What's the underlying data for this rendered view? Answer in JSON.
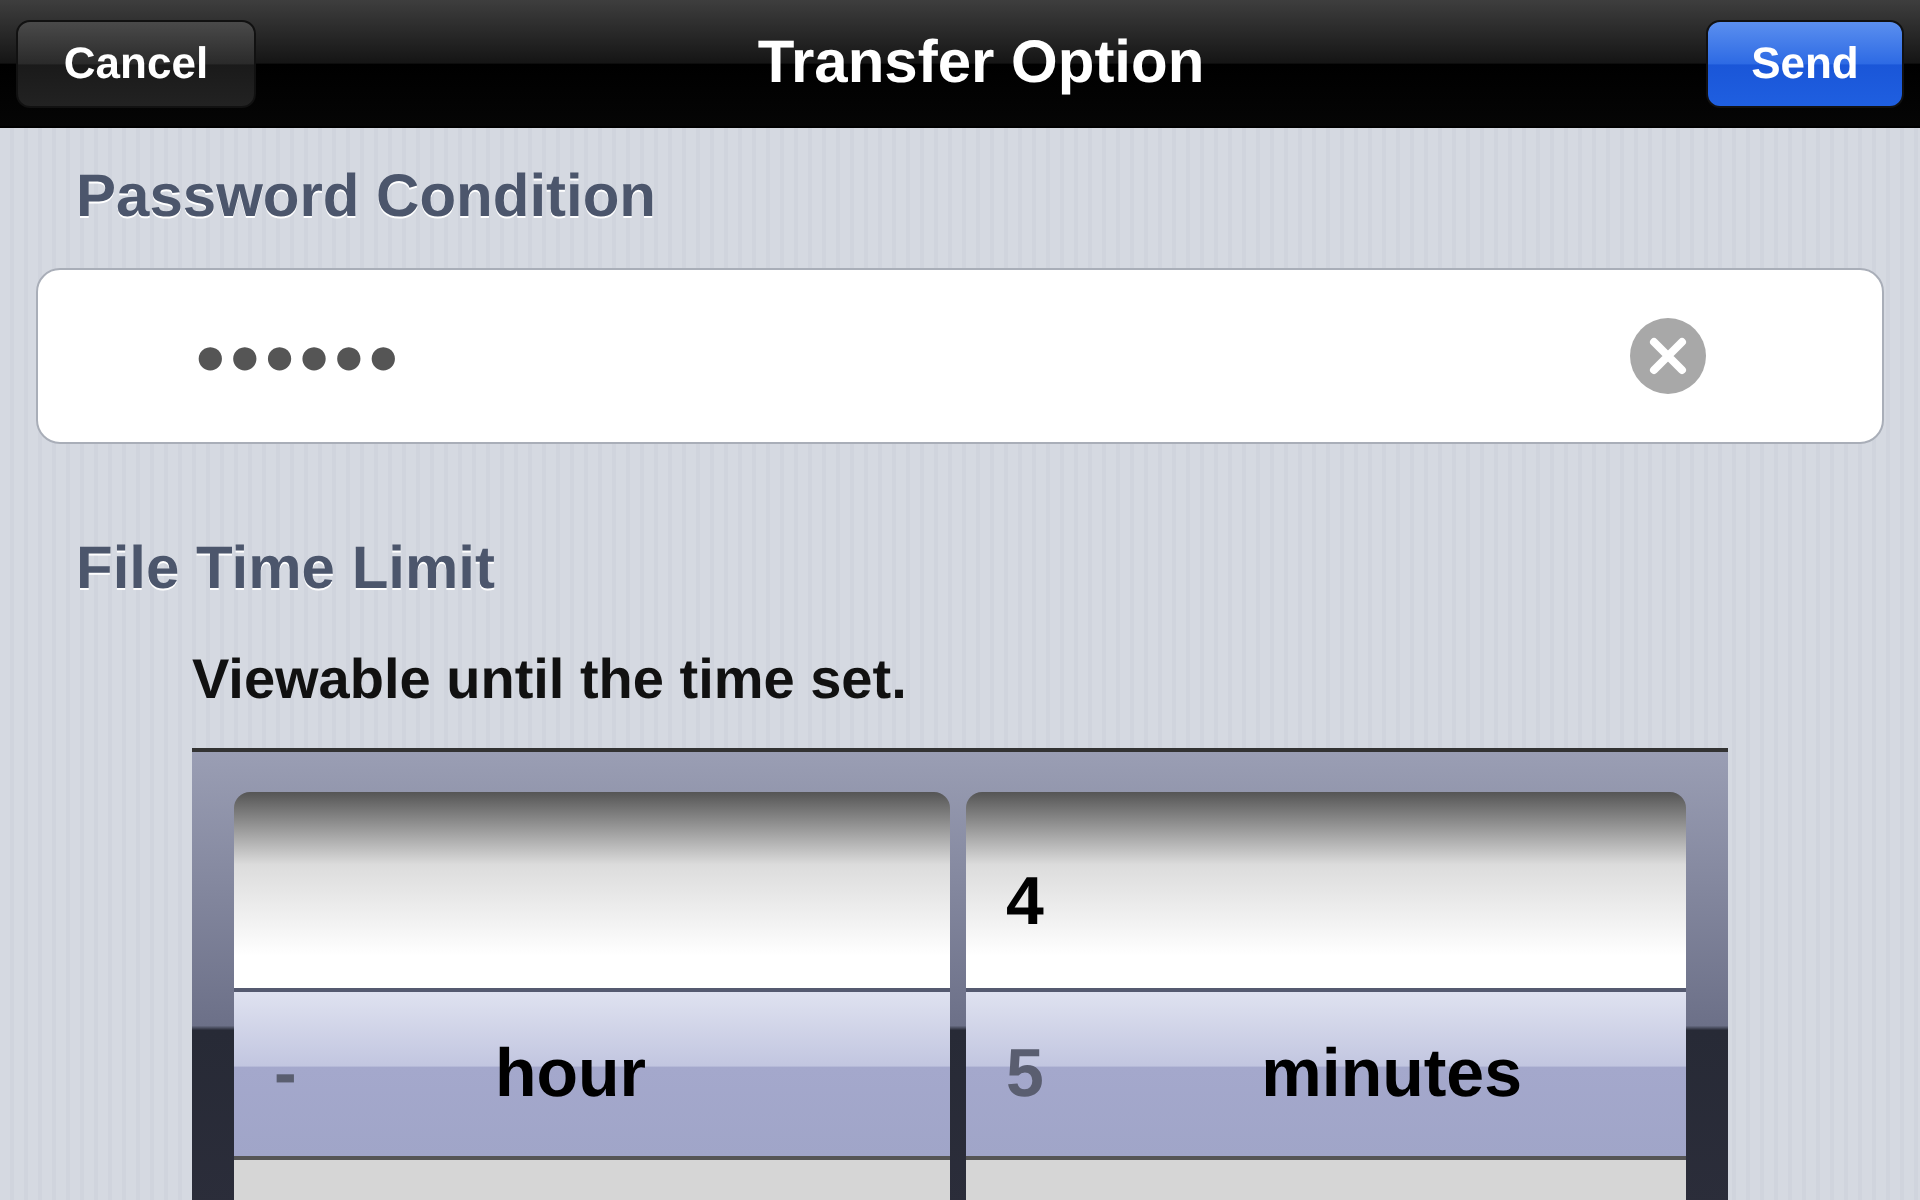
{
  "nav": {
    "title": "Transfer Option",
    "buttons": [
      {
        "label": "Cancel",
        "kind": "plain"
      },
      {
        "label": "Send",
        "kind": "primary"
      }
    ]
  },
  "password": {
    "title": "Password Condition",
    "value": "●●●●●●"
  },
  "time_limit": {
    "title": "File Time Limit",
    "description": "Viewable until the time set.",
    "picker": {
      "columns": [
        {
          "label": "hour",
          "rows": [
            {
              "text": "-",
              "selected": true
            }
          ]
        },
        {
          "label": "minutes",
          "rows": [
            {
              "text": "4",
              "selected": false
            },
            {
              "text": "5",
              "selected": true
            }
          ]
        }
      ]
    }
  }
}
